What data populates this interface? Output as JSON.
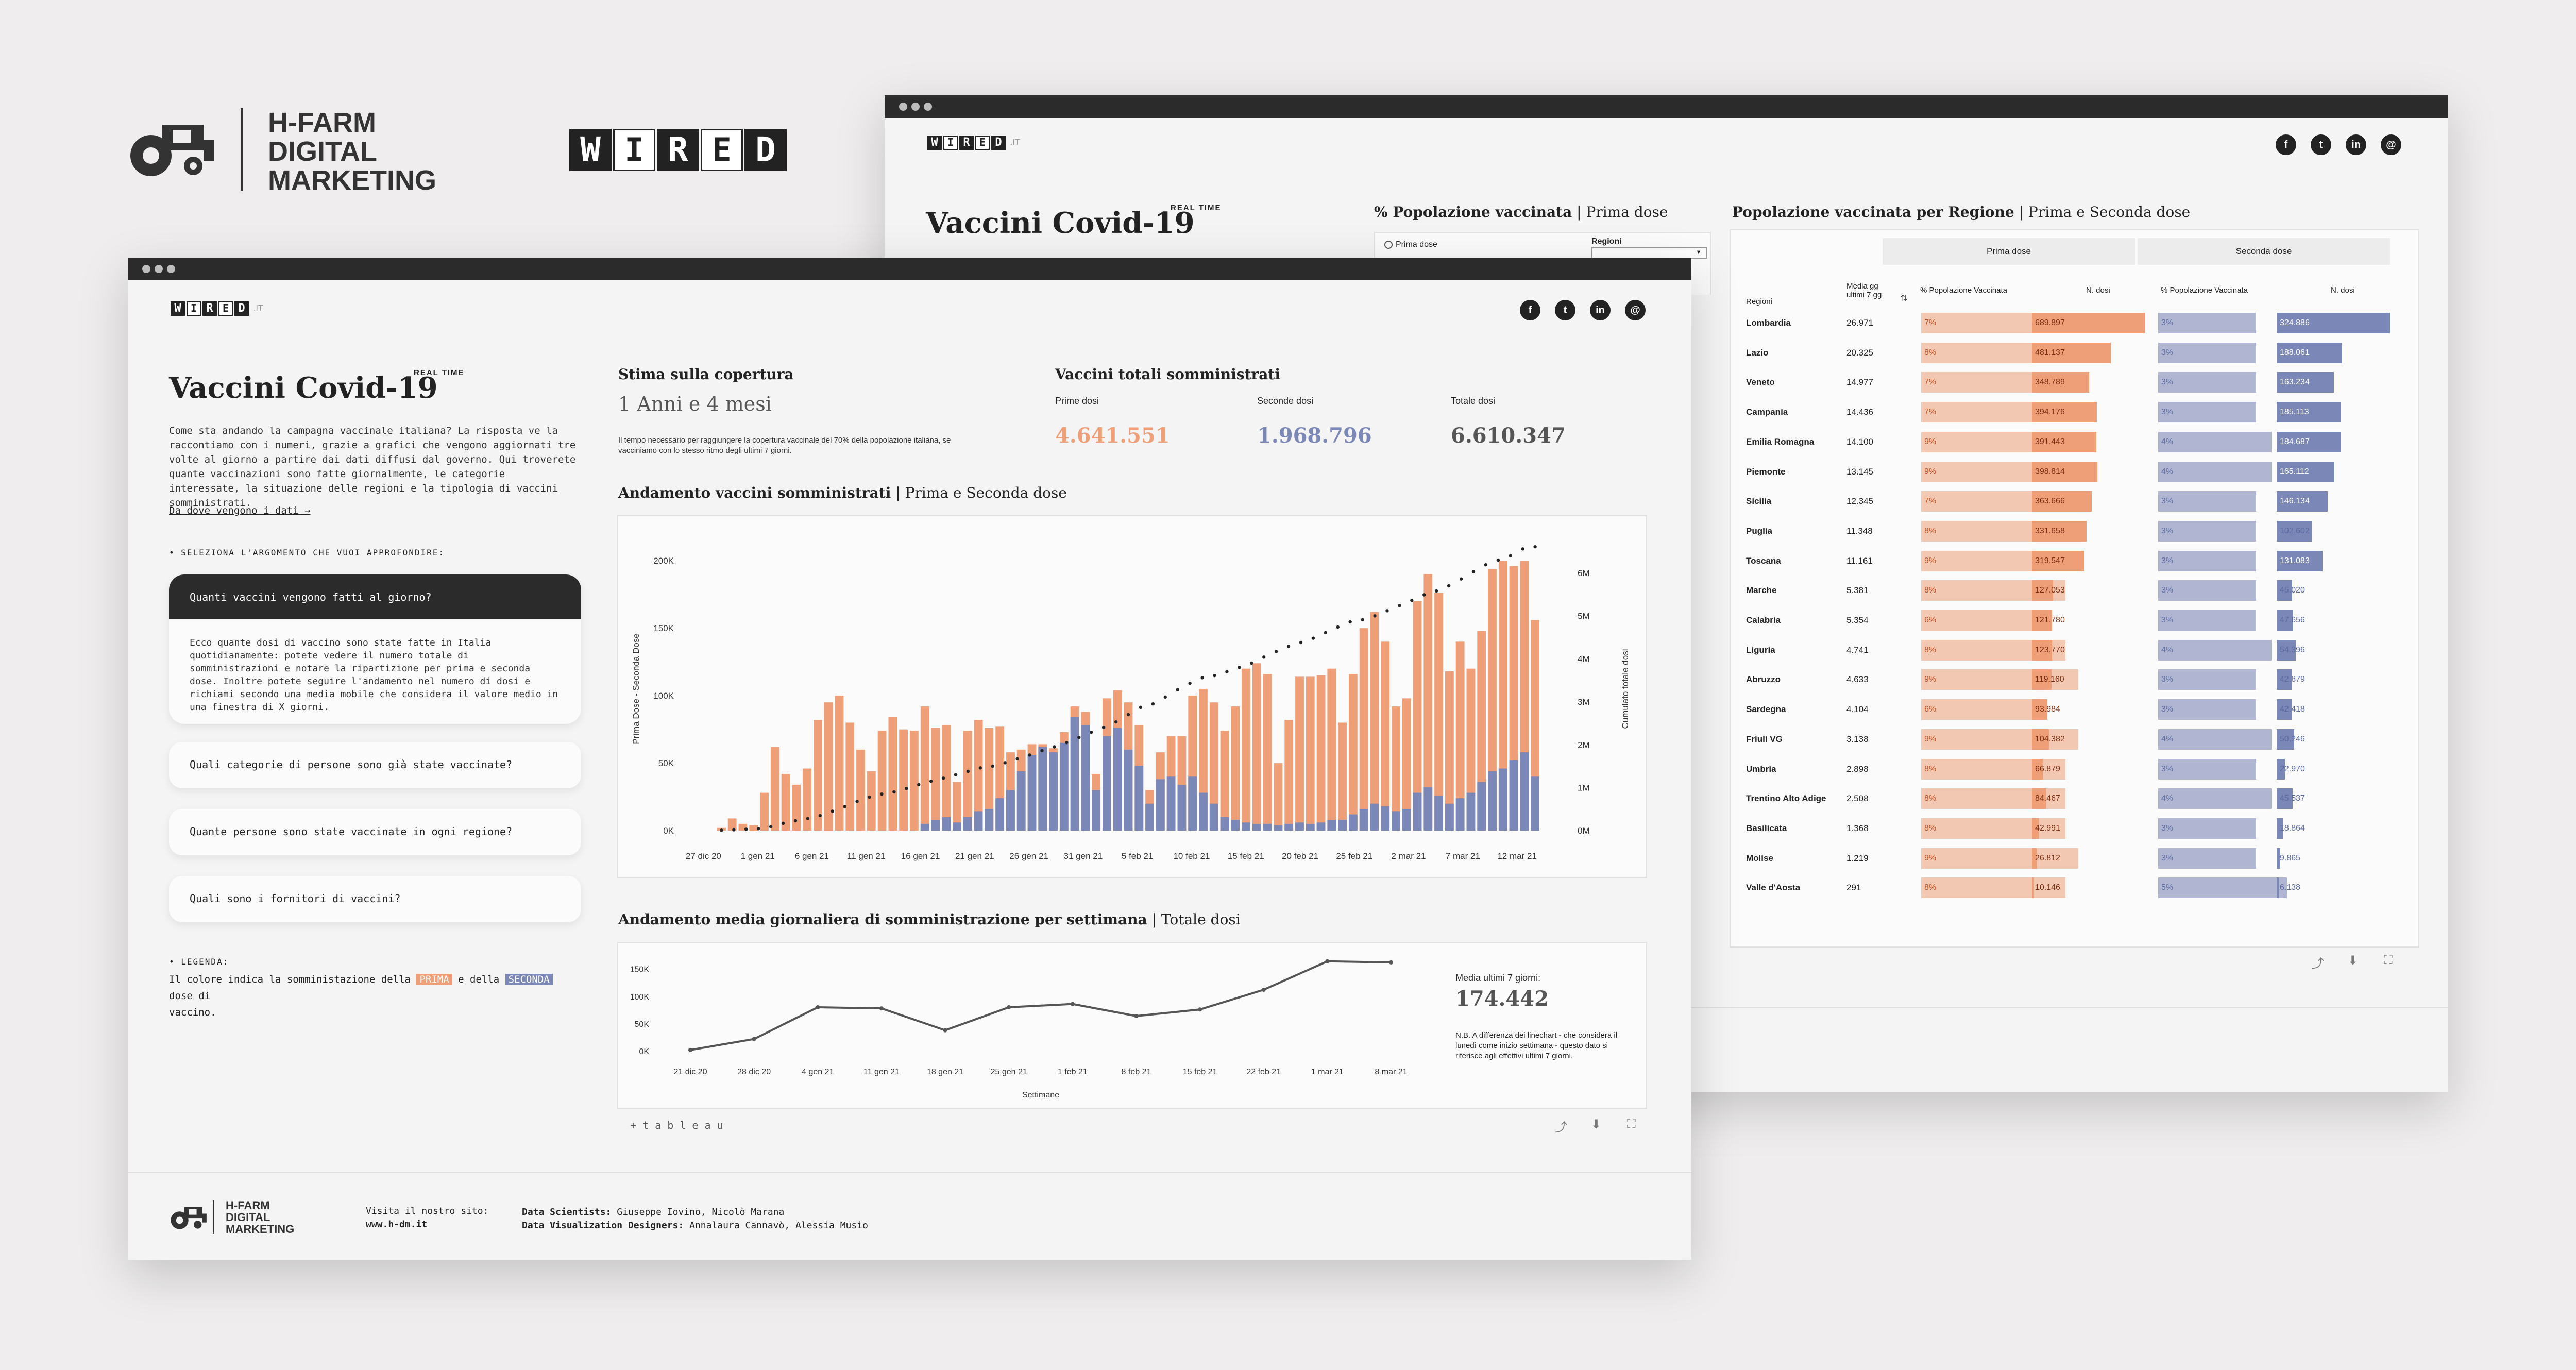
{
  "brand": {
    "hfarm_lines": [
      "H-FARM",
      "DIGITAL",
      "MARKETING"
    ],
    "wired_letters": [
      "W",
      "I",
      "R",
      "E",
      "D"
    ],
    "wired_suffix": ".IT"
  },
  "colors": {
    "prima": "#ef9f77",
    "seconda": "#7b87b6",
    "bg": "#f5f4f4",
    "dark": "#2b2b2b"
  },
  "social_icons": [
    "facebook-icon",
    "twitter-icon",
    "linkedin-icon",
    "mail-icon"
  ],
  "front": {
    "title": "Vaccini Covid-19",
    "realtime": "REAL TIME",
    "intro": "Come sta andando la campagna vaccinale italiana? La risposta ve la raccontiamo con i numeri, grazie a grafici che vengono aggiornati tre volte al giorno a partire dai dati diffusi dal governo. Qui troverete quante vaccinazioni sono fatte giornalmente, le categorie interessate, la situazione delle regioni e la tipologia di vaccini somministrati.",
    "data_link": "Da dove vengono i dati →",
    "select_label": "• SELEZIONA L'ARGOMENTO CHE VUOI APPROFONDIRE:",
    "active_question": "Quanti vaccini vengono fatti al giorno?",
    "active_answer": "Ecco quante dosi di vaccino sono state fatte in Italia quotidianamente: potete vedere il numero totale di somministrazioni e notare la ripartizione per prima e seconda dose. Inoltre potete seguire l'andamento nel numero di dosi e richiami secondo una media mobile che considera il valore medio in una finestra di X giorni.",
    "questions": [
      "Quali categorie di persone sono già state vaccinate?",
      "Quante persone sono state vaccinate in ogni regione?",
      "Quali sono i fornitori di vaccini?"
    ],
    "legend_label": "• LEGENDA:",
    "legend_pre": "Il colore indica la somministazione della",
    "legend_prima": "PRIMA",
    "legend_mid": "e della",
    "legend_seconda": "SECONDA",
    "legend_post": "dose di",
    "legend_end": "vaccino.",
    "stima_title": "Stima sulla copertura",
    "stima_value": "1 Anni e 4 mesi",
    "stima_note": "Il tempo necessario per raggiungere la copertura vaccinale del 70% della popolazione italiana, se vacciniamo con lo stesso ritmo degli ultimi 7 giorni.",
    "totali_title": "Vaccini totali somministrati",
    "kpis": [
      {
        "label": "Prime dosi",
        "value": "4.641.551"
      },
      {
        "label": "Seconde dosi",
        "value": "1.968.796"
      },
      {
        "label": "Totale dosi",
        "value": "6.610.347"
      }
    ],
    "chart1_title": "Andamento vaccini somministrati",
    "chart1_sub": "| Prima e Seconda dose",
    "chart2_title": "Andamento media giornaliera di somministrazione per settimana",
    "chart2_sub": "| Totale dosi",
    "media_label": "Media ultimi 7 giorni:",
    "media_value": "174.442",
    "media_note": "N.B. A differenza dei linechart - che considera il lunedì come inizio settimana - questo dato si riferisce agli effettivi ultimi 7 giorni.",
    "tableau": "+ t a b l e a u",
    "footer_visit": "Visita il nostro sito:",
    "footer_site": "www.h-dm.it",
    "footer_ds_label": "Data Scientists:",
    "footer_ds": "Giuseppe Iovino, Nicolò Marana",
    "footer_dv_label": "Data Visualization Designers:",
    "footer_dv": "Annalaura Cannavò, Alessia Musio"
  },
  "back": {
    "title": "Vaccini Covid-19",
    "realtime": "REAL TIME",
    "pop_title": "% Popolazione vaccinata",
    "pop_sub": "| Prima dose",
    "radio_label": "Prima dose",
    "select_label": "Regioni",
    "reg_title": "Popolazione vaccinata per Regione",
    "reg_sub": "| Prima e Seconda dose",
    "group_prima": "Prima dose",
    "group_seconda": "Seconda dose",
    "col_regioni": "Regioni",
    "col_media": "Media gg ultimi 7 gg",
    "col_pct1": "% Popolazione Vaccinata",
    "col_n1": "N. dosi",
    "col_pct2": "% Popolazione Vaccinata",
    "col_n2": "N. dosi",
    "rows": [
      {
        "region": "Lombardia",
        "media": "26.971",
        "p1": "7%",
        "n1": "689.897",
        "p2": "3%",
        "n2": "324.886",
        "v1": 689897,
        "v2": 324886,
        "pp1": 7,
        "pp2": 3
      },
      {
        "region": "Lazio",
        "media": "20.325",
        "p1": "8%",
        "n1": "481.137",
        "p2": "3%",
        "n2": "188.061",
        "v1": 481137,
        "v2": 188061,
        "pp1": 8,
        "pp2": 3
      },
      {
        "region": "Veneto",
        "media": "14.977",
        "p1": "7%",
        "n1": "348.789",
        "p2": "3%",
        "n2": "163.234",
        "v1": 348789,
        "v2": 163234,
        "pp1": 7,
        "pp2": 3
      },
      {
        "region": "Campania",
        "media": "14.436",
        "p1": "7%",
        "n1": "394.176",
        "p2": "3%",
        "n2": "185.113",
        "v1": 394176,
        "v2": 185113,
        "pp1": 7,
        "pp2": 3
      },
      {
        "region": "Emilia Romagna",
        "media": "14.100",
        "p1": "9%",
        "n1": "391.443",
        "p2": "4%",
        "n2": "184.687",
        "v1": 391443,
        "v2": 184687,
        "pp1": 9,
        "pp2": 4
      },
      {
        "region": "Piemonte",
        "media": "13.145",
        "p1": "9%",
        "n1": "398.814",
        "p2": "4%",
        "n2": "165.112",
        "v1": 398814,
        "v2": 165112,
        "pp1": 9,
        "pp2": 4
      },
      {
        "region": "Sicilia",
        "media": "12.345",
        "p1": "7%",
        "n1": "363.666",
        "p2": "3%",
        "n2": "146.134",
        "v1": 363666,
        "v2": 146134,
        "pp1": 7,
        "pp2": 3
      },
      {
        "region": "Puglia",
        "media": "11.348",
        "p1": "8%",
        "n1": "331.658",
        "p2": "3%",
        "n2": "102.602",
        "v1": 331658,
        "v2": 102602,
        "pp1": 8,
        "pp2": 3
      },
      {
        "region": "Toscana",
        "media": "11.161",
        "p1": "9%",
        "n1": "319.547",
        "p2": "3%",
        "n2": "131.083",
        "v1": 319547,
        "v2": 131083,
        "pp1": 9,
        "pp2": 3
      },
      {
        "region": "Marche",
        "media": "5.381",
        "p1": "8%",
        "n1": "127.053",
        "p2": "3%",
        "n2": "45.020",
        "v1": 127053,
        "v2": 45020,
        "pp1": 8,
        "pp2": 3
      },
      {
        "region": "Calabria",
        "media": "5.354",
        "p1": "6%",
        "n1": "121.780",
        "p2": "3%",
        "n2": "47.656",
        "v1": 121780,
        "v2": 47656,
        "pp1": 6,
        "pp2": 3
      },
      {
        "region": "Liguria",
        "media": "4.741",
        "p1": "8%",
        "n1": "123.770",
        "p2": "4%",
        "n2": "54.396",
        "v1": 123770,
        "v2": 54396,
        "pp1": 8,
        "pp2": 4
      },
      {
        "region": "Abruzzo",
        "media": "4.633",
        "p1": "9%",
        "n1": "119.160",
        "p2": "3%",
        "n2": "42.879",
        "v1": 119160,
        "v2": 42879,
        "pp1": 9,
        "pp2": 3
      },
      {
        "region": "Sardegna",
        "media": "4.104",
        "p1": "6%",
        "n1": "93.984",
        "p2": "3%",
        "n2": "42.418",
        "v1": 93984,
        "v2": 42418,
        "pp1": 6,
        "pp2": 3
      },
      {
        "region": "Friuli VG",
        "media": "3.138",
        "p1": "9%",
        "n1": "104.382",
        "p2": "4%",
        "n2": "50.246",
        "v1": 104382,
        "v2": 50246,
        "pp1": 9,
        "pp2": 4
      },
      {
        "region": "Umbria",
        "media": "2.898",
        "p1": "8%",
        "n1": "66.879",
        "p2": "3%",
        "n2": "22.970",
        "v1": 66879,
        "v2": 22970,
        "pp1": 8,
        "pp2": 3
      },
      {
        "region": "Trentino Alto Adige",
        "media": "2.508",
        "p1": "8%",
        "n1": "84.467",
        "p2": "4%",
        "n2": "45.537",
        "v1": 84467,
        "v2": 45537,
        "pp1": 8,
        "pp2": 4
      },
      {
        "region": "Basilicata",
        "media": "1.368",
        "p1": "8%",
        "n1": "42.991",
        "p2": "3%",
        "n2": "18.864",
        "v1": 42991,
        "v2": 18864,
        "pp1": 8,
        "pp2": 3
      },
      {
        "region": "Molise",
        "media": "1.219",
        "p1": "9%",
        "n1": "26.812",
        "p2": "3%",
        "n2": "9.865",
        "v1": 26812,
        "v2": 9865,
        "pp1": 9,
        "pp2": 3
      },
      {
        "region": "Valle d'Aosta",
        "media": "291",
        "p1": "8%",
        "n1": "10.146",
        "p2": "5%",
        "n2": "6.138",
        "v1": 10146,
        "v2": 6138,
        "pp1": 8,
        "pp2": 5
      }
    ]
  },
  "chart_data": [
    {
      "type": "bar",
      "title": "Andamento vaccini somministrati",
      "stacked": true,
      "ylabel": "Prima Dose - Seconda Dose",
      "y2label": "Cumulato totale dosi",
      "ylim": [
        0,
        210000
      ],
      "y2lim": [
        0,
        6600000
      ],
      "yticks": [
        "0K",
        "50K",
        "100K",
        "150K",
        "200K"
      ],
      "y2ticks": [
        "0M",
        "1M",
        "2M",
        "3M",
        "4M",
        "5M",
        "6M"
      ],
      "xticks": [
        "27 dic 20",
        "1 gen 21",
        "6 gen 21",
        "11 gen 21",
        "16 gen 21",
        "21 gen 21",
        "26 gen 21",
        "31 gen 21",
        "5 feb 21",
        "10 feb 21",
        "15 feb 21",
        "20 feb 21",
        "25 feb 21",
        "2 mar 21",
        "7 mar 21",
        "12 mar 21"
      ],
      "series": [
        {
          "name": "Prima dose",
          "values": [
            2000,
            9000,
            5000,
            4000,
            28000,
            62000,
            42000,
            34000,
            46000,
            82000,
            95000,
            100000,
            80000,
            60000,
            44000,
            74000,
            84000,
            75000,
            74000,
            92000,
            76000,
            78000,
            36000,
            74000,
            82000,
            76000,
            77000,
            58000,
            60000,
            64000,
            64000,
            61000,
            73000,
            92000,
            88000,
            42000,
            98000,
            104000,
            95000,
            78000,
            30000,
            58000,
            70000,
            70000,
            100000,
            105000,
            95000,
            74000,
            92000,
            120000,
            124000,
            116000,
            50000,
            82000,
            114000,
            114000,
            115000,
            120000,
            80000,
            116000,
            150000,
            162000,
            140000,
            92000,
            98000,
            170000,
            190000,
            176000,
            118000,
            140000,
            120000,
            148000,
            194000,
            200000,
            196000,
            200000,
            156000
          ]
        },
        {
          "name": "Seconda dose",
          "values": [
            0,
            0,
            0,
            0,
            0,
            0,
            0,
            0,
            0,
            0,
            0,
            0,
            0,
            0,
            0,
            0,
            0,
            0,
            0,
            5000,
            8000,
            10000,
            6000,
            10000,
            14000,
            16000,
            24000,
            30000,
            44000,
            56000,
            62000,
            58000,
            65000,
            84000,
            78000,
            30000,
            70000,
            76000,
            60000,
            48000,
            20000,
            38000,
            40000,
            34000,
            40000,
            28000,
            20000,
            10000,
            8000,
            6000,
            5000,
            5000,
            4000,
            5000,
            6000,
            5000,
            6000,
            8000,
            8000,
            12000,
            16000,
            20000,
            18000,
            14000,
            16000,
            28000,
            32000,
            26000,
            20000,
            24000,
            28000,
            36000,
            44000,
            46000,
            52000,
            58000,
            40000
          ]
        },
        {
          "name": "Cumulato totale dosi",
          "points": [
            [
              0,
              8000
            ],
            [
              1,
              18000
            ],
            [
              2,
              30000
            ],
            [
              3,
              45000
            ],
            [
              4,
              90000
            ],
            [
              5,
              170000
            ],
            [
              6,
              230000
            ],
            [
              7,
              280000
            ],
            [
              8,
              350000
            ],
            [
              9,
              450000
            ],
            [
              10,
              560000
            ],
            [
              11,
              680000
            ],
            [
              12,
              780000
            ],
            [
              13,
              850000
            ],
            [
              14,
              900000
            ],
            [
              15,
              980000
            ],
            [
              16,
              1070000
            ],
            [
              17,
              1150000
            ],
            [
              18,
              1220000
            ],
            [
              19,
              1300000
            ],
            [
              20,
              1380000
            ],
            [
              21,
              1460000
            ],
            [
              22,
              1500000
            ],
            [
              23,
              1580000
            ],
            [
              24,
              1670000
            ],
            [
              25,
              1760000
            ],
            [
              26,
              1860000
            ],
            [
              27,
              1950000
            ],
            [
              28,
              2050000
            ],
            [
              29,
              2170000
            ],
            [
              30,
              2290000
            ],
            [
              31,
              2400000
            ],
            [
              32,
              2530000
            ],
            [
              33,
              2700000
            ],
            [
              34,
              2870000
            ],
            [
              35,
              2950000
            ],
            [
              36,
              3110000
            ],
            [
              37,
              3280000
            ],
            [
              38,
              3430000
            ],
            [
              39,
              3560000
            ],
            [
              40,
              3610000
            ],
            [
              41,
              3700000
            ],
            [
              42,
              3800000
            ],
            [
              43,
              3900000
            ],
            [
              44,
              4040000
            ],
            [
              45,
              4170000
            ],
            [
              46,
              4290000
            ],
            [
              47,
              4380000
            ],
            [
              48,
              4480000
            ],
            [
              49,
              4610000
            ],
            [
              50,
              4740000
            ],
            [
              51,
              4860000
            ],
            [
              52,
              4910000
            ],
            [
              53,
              5000000
            ],
            [
              54,
              5120000
            ],
            [
              55,
              5240000
            ],
            [
              56,
              5360000
            ],
            [
              57,
              5490000
            ],
            [
              58,
              5580000
            ],
            [
              59,
              5700000
            ],
            [
              60,
              5860000
            ],
            [
              61,
              6030000
            ],
            [
              62,
              6190000
            ],
            [
              63,
              6300000
            ],
            [
              64,
              6400000
            ],
            [
              65,
              6560000
            ],
            [
              66,
              6610000
            ]
          ]
        }
      ]
    },
    {
      "type": "line",
      "title": "Andamento media giornaliera di somministrazione per settimana",
      "xlabel": "Settimane",
      "ylim": [
        0,
        160000
      ],
      "yticks": [
        "0K",
        "50K",
        "100K",
        "150K"
      ],
      "categories": [
        "21 dic 20",
        "28 dic 20",
        "4 gen 21",
        "11 gen 21",
        "18 gen 21",
        "25 gen 21",
        "1 feb 21",
        "8 feb 21",
        "15 feb 21",
        "22 feb 21",
        "1 mar 21",
        "8 mar 21"
      ],
      "series": [
        {
          "name": "Totale dosi",
          "values": [
            2000,
            22000,
            80000,
            78000,
            38000,
            80000,
            86000,
            64000,
            76000,
            112000,
            164000,
            162000
          ]
        }
      ]
    }
  ]
}
